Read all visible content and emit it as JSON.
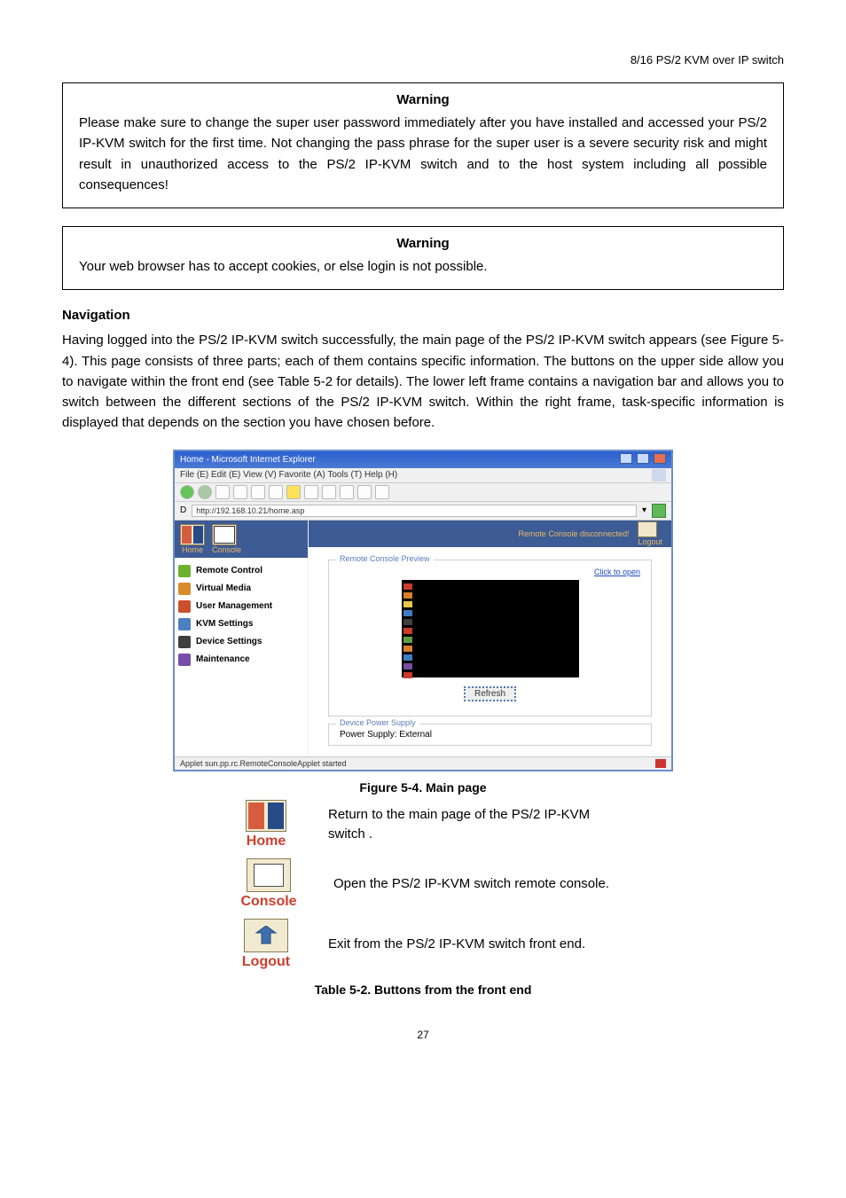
{
  "header": {
    "product": "8/16 PS/2 KVM over IP switch"
  },
  "warning1": {
    "title": "Warning",
    "body": "Please make sure to change the super user password immediately after you have installed and accessed your PS/2 IP-KVM switch for the first time. Not changing the pass phrase for the super user is a severe security risk and might result in unauthorized access to the PS/2 IP-KVM switch and to the host system including all possible consequences!"
  },
  "warning2": {
    "title": "Warning",
    "body": "Your web browser has to accept cookies, or else login is not possible."
  },
  "navigation": {
    "heading": "Navigation",
    "para": "Having logged into the PS/2 IP-KVM switch successfully, the main page of the PS/2 IP-KVM switch appears (see Figure 5-4). This page consists of three parts; each of them contains specific information. The buttons on the upper side allow you to navigate within the front end (see Table 5-2 for details). The lower left frame contains a navigation bar and allows you to switch between the different sections of the PS/2 IP-KVM switch. Within the right frame, task-specific information is displayed that depends on the section you have chosen before."
  },
  "browser": {
    "title": "Home - Microsoft Internet Explorer",
    "menubar": "File (E)  Edit (E)  View (V)  Favorite (A)  Tools (T)  Help (H)",
    "address": "http://192.168.10.21/home.asp",
    "go_hint": "Go",
    "side_home": "Home",
    "side_console": "Console",
    "side_items": [
      {
        "label": "Remote Control",
        "color": "#6fb12e"
      },
      {
        "label": "Virtual Media",
        "color": "#d98c2b"
      },
      {
        "label": "User Management",
        "color": "#c94f2f"
      },
      {
        "label": "KVM Settings",
        "color": "#4d80c2"
      },
      {
        "label": "Device Settings",
        "color": "#3f3f3f"
      },
      {
        "label": "Maintenance",
        "color": "#794ea8"
      }
    ],
    "status_text": "Remote Console disconnected!",
    "logout_label": "Logout",
    "preview_legend": "Remote Console Preview",
    "click_open": "Click to open",
    "refresh": "Refresh",
    "power_legend": "Device Power Supply",
    "power_text": "Power Supply: External",
    "statusbar": "Applet sun.pp.rc.RemoteConsoleApplet started"
  },
  "figure_caption": "Figure 5-4. Main page",
  "buttons": {
    "home": {
      "label": "Home",
      "desc": " Return to the main page of the PS/2 IP-KVM switch ."
    },
    "console": {
      "label": "Console",
      "desc": " Open the PS/2 IP-KVM switch remote console."
    },
    "logout": {
      "label": "Logout",
      "desc": " Exit from the PS/2 IP-KVM switch front end."
    }
  },
  "table_caption": "Table 5-2. Buttons from the front end",
  "page_number": "27"
}
